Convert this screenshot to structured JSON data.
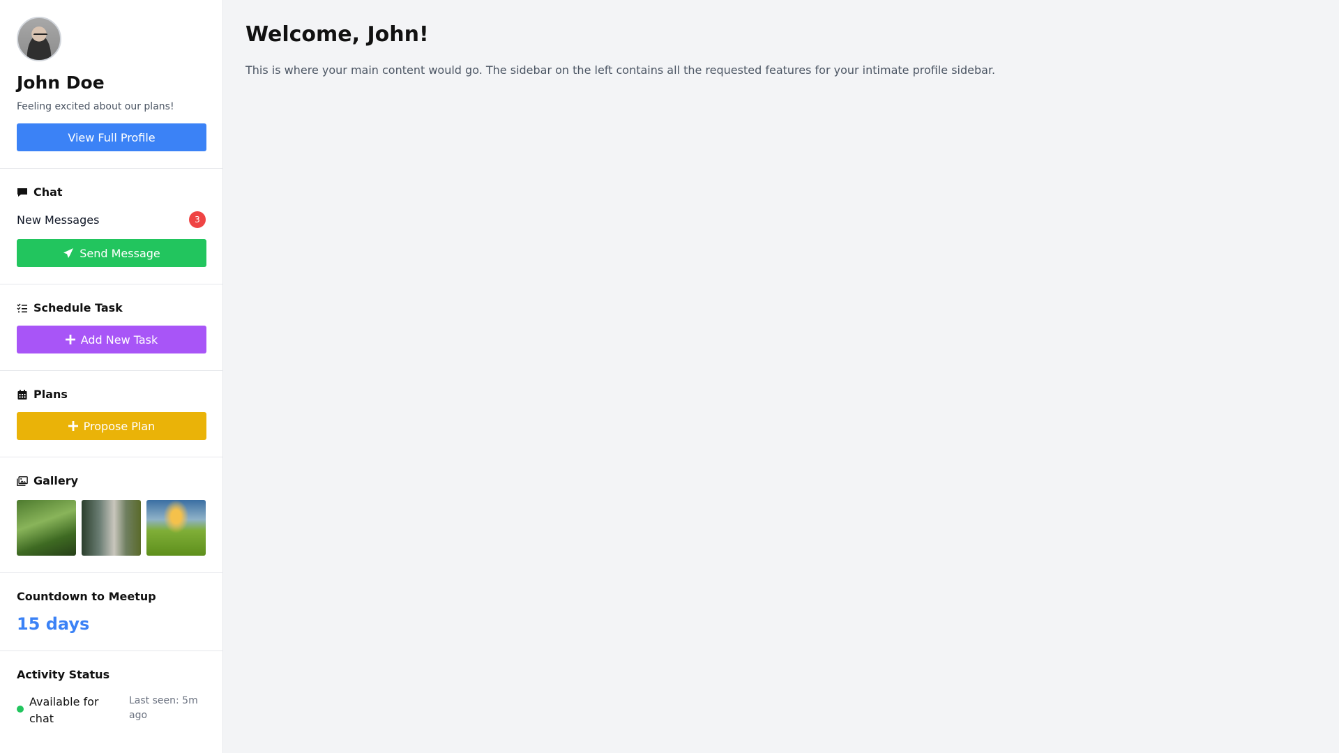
{
  "profile": {
    "name": "John Doe",
    "mood": "Feeling excited about our plans!",
    "view_profile_label": "View Full Profile"
  },
  "chat": {
    "title": "Chat",
    "new_messages_label": "New Messages",
    "new_messages_count": "3",
    "send_label": "Send Message"
  },
  "schedule": {
    "title": "Schedule Task",
    "add_label": "Add New Task"
  },
  "plans": {
    "title": "Plans",
    "propose_label": "Propose Plan"
  },
  "gallery": {
    "title": "Gallery",
    "images": [
      "terraced green hills",
      "granite cliff forest",
      "green field sunset"
    ]
  },
  "countdown": {
    "title": "Countdown to Meetup",
    "value": "15 days"
  },
  "activity": {
    "title": "Activity Status",
    "status": "Available for chat",
    "last_seen": "Last seen: 5m ago"
  },
  "main": {
    "welcome": "Welcome, John!",
    "lead": "This is where your main content would go. The sidebar on the left contains all the requested features for your intimate profile sidebar."
  },
  "colors": {
    "blue": "#3b82f6",
    "green": "#22c55e",
    "purple": "#a855f7",
    "yellow": "#eab308",
    "badge_red": "#ef4444"
  }
}
